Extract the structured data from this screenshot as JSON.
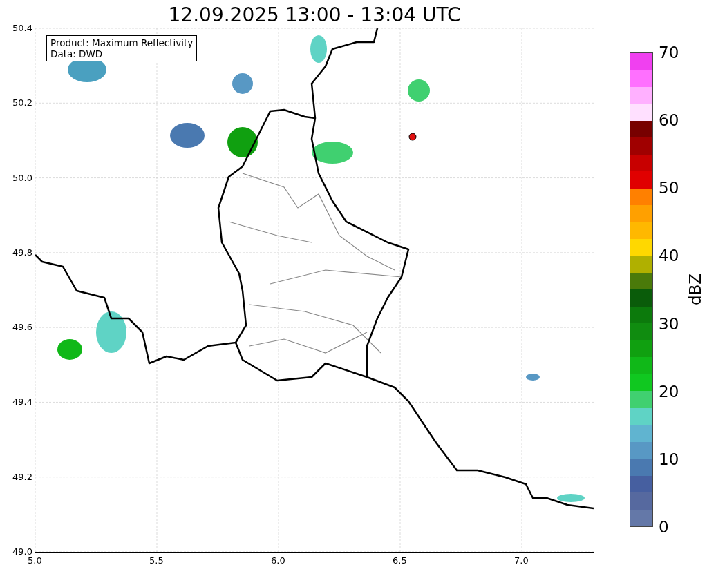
{
  "title": "12.09.2025 13:00 - 13:04 UTC",
  "map": {
    "legend": [
      "Product: Maximum Reflectivity",
      "Data: DWD"
    ],
    "xticks": [
      "5.0",
      "5.5",
      "6.0",
      "6.5",
      "7.0"
    ],
    "yticks": [
      "50.4",
      "50.2",
      "50.0",
      "49.8",
      "49.6",
      "49.4",
      "49.2",
      "49.0"
    ]
  },
  "colorbar": {
    "label": "dBZ",
    "ticks": [
      "70",
      "60",
      "50",
      "40",
      "30",
      "20",
      "10",
      "0"
    ],
    "segments": [
      {
        "color": "#6478a8"
      },
      {
        "color": "#56699f"
      },
      {
        "color": "#465fa0"
      },
      {
        "color": "#4a79b0"
      },
      {
        "color": "#5898c4"
      },
      {
        "color": "#60b4d0"
      },
      {
        "color": "#5fd3c5"
      },
      {
        "color": "#40d070"
      },
      {
        "color": "#10c820"
      },
      {
        "color": "#10b818"
      },
      {
        "color": "#10a010"
      },
      {
        "color": "#108c10"
      },
      {
        "color": "#0c7a0c"
      },
      {
        "color": "#0a5c0a"
      },
      {
        "color": "#4a7a0a"
      },
      {
        "color": "#b0b000"
      },
      {
        "color": "#ffd800"
      },
      {
        "color": "#ffb800"
      },
      {
        "color": "#ffa000"
      },
      {
        "color": "#ff8000"
      },
      {
        "color": "#e00000"
      },
      {
        "color": "#c80000"
      },
      {
        "color": "#a00000"
      },
      {
        "color": "#780000"
      },
      {
        "color": "#ffe0ff"
      },
      {
        "color": "#ffb0ff"
      },
      {
        "color": "#ff70ff"
      },
      {
        "color": "#f040f0"
      }
    ]
  }
}
